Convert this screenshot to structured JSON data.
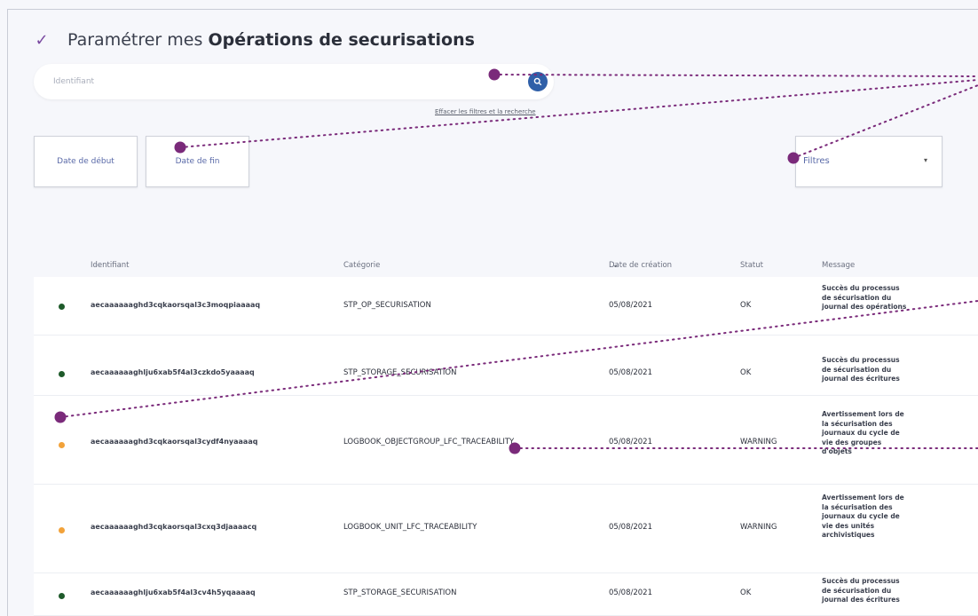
{
  "header": {
    "title_prefix": "Paramétrer mes",
    "title_strong": "Opérations de securisations"
  },
  "search": {
    "placeholder": "Identifiant",
    "clear_link": "Effacer les filtres et la recherche"
  },
  "dates": {
    "start_label": "Date de début",
    "end_label": "Date de fin"
  },
  "filter": {
    "label": "Filtres"
  },
  "table": {
    "columns": [
      "Identifiant",
      "Catégorie",
      "Date de création",
      "Statut",
      "Message"
    ],
    "rows": [
      {
        "id": "aecaaaaaaghd3cqkaorsqal3c3moqpiaaaaq",
        "category": "STP_OP_SECURISATION",
        "date": "05/08/2021",
        "status": "OK",
        "message": "Succès du processus de sécurisation du journal des opérations",
        "status_color": "#1e5a2a"
      },
      {
        "id": "aecaaaaaaghlju6xab5f4al3czkdo5yaaaaq",
        "category": "STP_STORAGE_SECURISATION",
        "date": "05/08/2021",
        "status": "OK",
        "message": "Succès du processus de sécurisation du journal des écritures",
        "status_color": "#1e5a2a"
      },
      {
        "id": "aecaaaaaaghd3cqkaorsqal3cydf4nyaaaaq",
        "category": "LOGBOOK_OBJECTGROUP_LFC_TRACEABILITY",
        "date": "05/08/2021",
        "status": "WARNING",
        "message": "Avertissement lors de la sécurisation des journaux du cycle de vie des groupes d'objets",
        "status_color": "#f2a23a"
      },
      {
        "id": "aecaaaaaaghd3cqkaorsqal3cxq3djaaaacq",
        "category": "LOGBOOK_UNIT_LFC_TRACEABILITY",
        "date": "05/08/2021",
        "status": "WARNING",
        "message": "Avertissement lors de la sécurisation des journaux du cycle de vie des unités archivistiques",
        "status_color": "#f2a23a"
      },
      {
        "id": "aecaaaaaaghlju6xab5f4al3cv4h5yqaaaaq",
        "category": "STP_STORAGE_SECURISATION",
        "date": "05/08/2021",
        "status": "OK",
        "message": "Succès du processus de sécurisation du journal des écritures",
        "status_color": "#1e5a2a"
      }
    ]
  },
  "colors": {
    "accent": "#2f5fa8",
    "annotation": "#7a2a7a",
    "ok": "#1e5a2a",
    "warning": "#f2a23a"
  }
}
